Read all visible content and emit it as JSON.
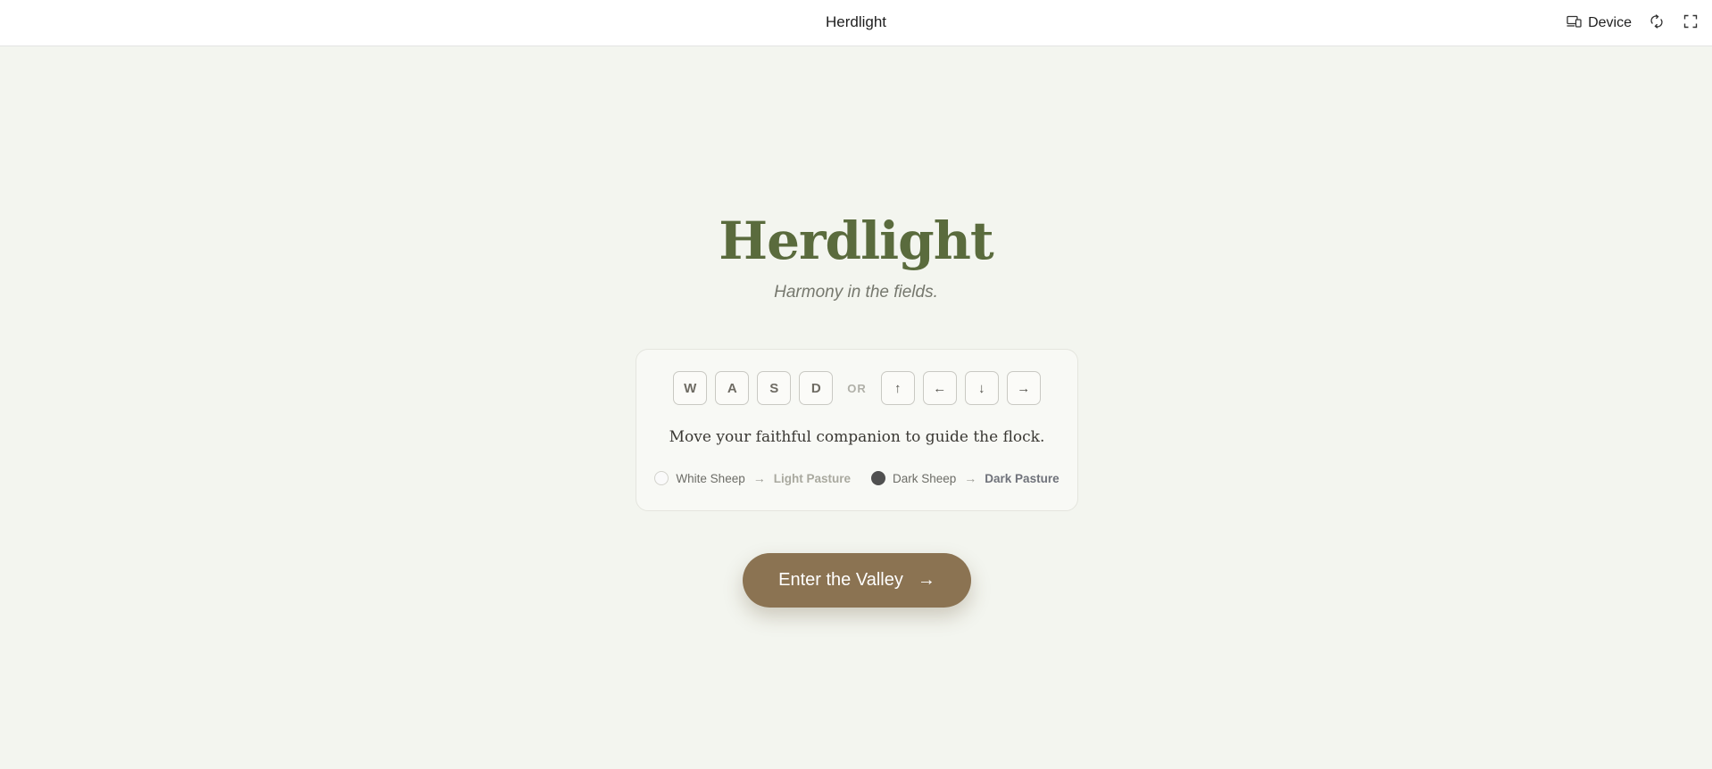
{
  "topbar": {
    "title": "Herdlight",
    "device_label": "Device",
    "icons": [
      "device-icon",
      "rotate-icon",
      "fullscreen-icon"
    ]
  },
  "hero": {
    "title": "Herdlight",
    "subtitle": "Harmony in the fields."
  },
  "controls": {
    "wasd_keys": [
      "W",
      "A",
      "S",
      "D"
    ],
    "separator": "OR",
    "arrow_keys": [
      "↑",
      "←",
      "↓",
      "→"
    ],
    "instructions": "Move your faithful companion to guide the flock."
  },
  "legend": [
    {
      "sheep": "White Sheep",
      "arrow": "→",
      "pasture": "Light Pasture",
      "sheep_color": "#fafafa"
    },
    {
      "sheep": "Dark Sheep",
      "arrow": "→",
      "pasture": "Dark Pasture",
      "sheep_color": "#505050"
    }
  ],
  "cta": {
    "label": "Enter the Valley",
    "arrow": "→"
  },
  "colors": {
    "background": "#f3f5ef",
    "title_green": "#5a6b3d",
    "button_brown": "#8b7352"
  }
}
